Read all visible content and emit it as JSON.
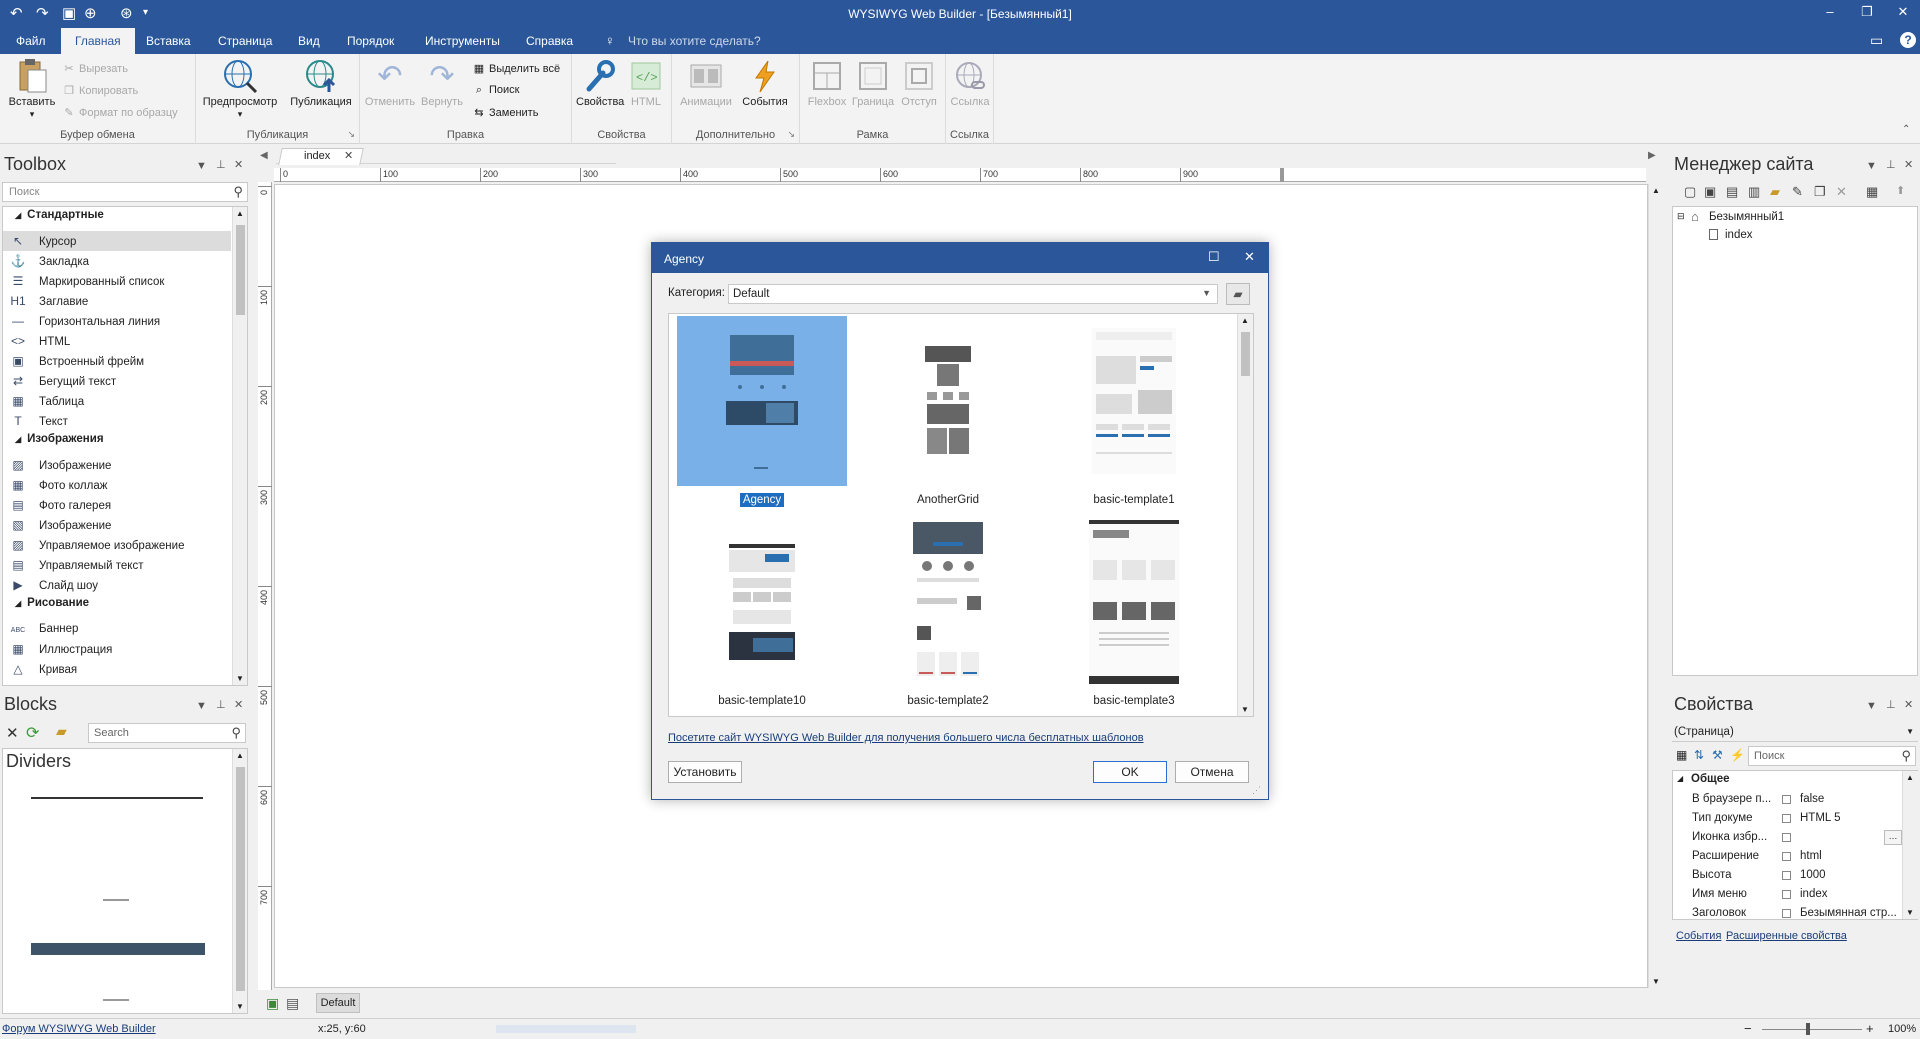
{
  "window": {
    "title": "WYSIWYG Web Builder - [Безымянный1]"
  },
  "menu": {
    "items": [
      "Файл",
      "Главная",
      "Вставка",
      "Страница",
      "Вид",
      "Порядок",
      "Инструменты",
      "Справка"
    ],
    "search_placeholder": "Что вы хотите сделать?"
  },
  "ribbon": {
    "clipboard": {
      "paste": "Вставить",
      "cut": "Вырезать",
      "copy": "Копировать",
      "format": "Формат по образцу",
      "group": "Буфер обмена"
    },
    "publish": {
      "preview": "Предпросмотр",
      "publish": "Публикация",
      "group": "Публикация"
    },
    "edit": {
      "undo": "Отменить",
      "redo": "Вернуть",
      "select_all": "Выделить всё",
      "find": "Поиск",
      "replace": "Заменить",
      "group": "Правка"
    },
    "props": {
      "properties": "Свойства",
      "html": "HTML",
      "group": "Свойства"
    },
    "extra": {
      "animations": "Анимации",
      "events": "События",
      "group": "Дополнительно"
    },
    "frame": {
      "flexbox": "Flexbox",
      "border": "Граница",
      "padding": "Отступ",
      "group": "Рамка"
    },
    "link": {
      "link": "Ссылка",
      "group": "Ссылка"
    }
  },
  "toolbox": {
    "title": "Toolbox",
    "search_placeholder": "Поиск",
    "categories": [
      {
        "name": "Стандартные",
        "items": [
          {
            "label": "Курсор",
            "icon": "cursor-icon",
            "glyph": "↖"
          },
          {
            "label": "Закладка",
            "icon": "anchor-icon",
            "glyph": "⚓"
          },
          {
            "label": "Маркированный список",
            "icon": "list-icon",
            "glyph": "☰"
          },
          {
            "label": "Заглавие",
            "icon": "heading-icon",
            "glyph": "H1"
          },
          {
            "label": "Горизонтальная линия",
            "icon": "hline-icon",
            "glyph": "—"
          },
          {
            "label": "HTML",
            "icon": "code-icon",
            "glyph": "<>"
          },
          {
            "label": "Встроенный фрейм",
            "icon": "iframe-icon",
            "glyph": "▣"
          },
          {
            "label": "Бегущий текст",
            "icon": "marquee-icon",
            "glyph": "⇄"
          },
          {
            "label": "Таблица",
            "icon": "table-icon",
            "glyph": "▦"
          },
          {
            "label": "Текст",
            "icon": "text-icon",
            "glyph": "T"
          }
        ]
      },
      {
        "name": "Изображения",
        "items": [
          {
            "label": "Изображение",
            "icon": "image-icon",
            "glyph": "▨"
          },
          {
            "label": "Фото коллаж",
            "icon": "collage-icon",
            "glyph": "▦"
          },
          {
            "label": "Фото галерея",
            "icon": "gallery-icon",
            "glyph": "▤"
          },
          {
            "label": "Изображение",
            "icon": "image-icon",
            "glyph": "▧"
          },
          {
            "label": "Управляемое изображение",
            "icon": "managed-image-icon",
            "glyph": "▨"
          },
          {
            "label": "Управляемый текст",
            "icon": "managed-text-icon",
            "glyph": "▤"
          },
          {
            "label": "Слайд шоу",
            "icon": "slideshow-icon",
            "glyph": "▶"
          }
        ]
      },
      {
        "name": "Рисование",
        "items": [
          {
            "label": "Баннер",
            "icon": "banner-icon",
            "glyph": "ABC"
          },
          {
            "label": "Иллюстрация",
            "icon": "illustration-icon",
            "glyph": "▦"
          },
          {
            "label": "Кривая",
            "icon": "curve-icon",
            "glyph": "△"
          }
        ]
      }
    ]
  },
  "blocks": {
    "title": "Blocks",
    "search_placeholder": "Search",
    "category": "Dividers"
  },
  "editor": {
    "tab": "index",
    "ruler_h": [
      "0",
      "100",
      "200",
      "300",
      "400",
      "500",
      "600",
      "700",
      "800",
      "900"
    ],
    "ruler_v": [
      "0",
      "100",
      "200",
      "300",
      "400",
      "500",
      "600",
      "700"
    ],
    "bottom_label": "Default"
  },
  "dialog": {
    "title": "Agency",
    "category_label": "Категория:",
    "category_value": "Default",
    "templates": [
      {
        "name": "Agency",
        "selected": true
      },
      {
        "name": "AnotherGrid",
        "selected": false
      },
      {
        "name": "basic-template1",
        "selected": false
      },
      {
        "name": "basic-template10",
        "selected": false
      },
      {
        "name": "basic-template2",
        "selected": false
      },
      {
        "name": "basic-template3",
        "selected": false
      }
    ],
    "link": "Посетите сайт WYSIWYG Web Builder для получения большего числа бесплатных шаблонов",
    "install": "Установить",
    "ok": "OK",
    "cancel": "Отмена"
  },
  "site_manager": {
    "title": "Менеджер сайта",
    "root": "Безымянный1",
    "page": "index"
  },
  "properties": {
    "title": "Свойства",
    "object": "(Страница)",
    "search_placeholder": "Поиск",
    "section": "Общее",
    "rows": [
      {
        "name": "В браузере п...",
        "value": "false"
      },
      {
        "name": "Тип докуме",
        "value": "HTML 5"
      },
      {
        "name": "Иконка избр...",
        "value": ""
      },
      {
        "name": "Расширение",
        "value": "html"
      },
      {
        "name": "Высота",
        "value": "1000"
      },
      {
        "name": "Имя меню",
        "value": "index"
      },
      {
        "name": "Заголовок",
        "value": "Безымянная стр..."
      }
    ],
    "links": [
      "События",
      "Расширенные свойства"
    ]
  },
  "status": {
    "forum": "Форум WYSIWYG Web Builder",
    "coords": "x:25, y:60",
    "zoom": "100%"
  },
  "colors": {
    "accent": "#2b579a",
    "selection": "#7ab0e8",
    "selected_label": "#1f6dc1"
  }
}
